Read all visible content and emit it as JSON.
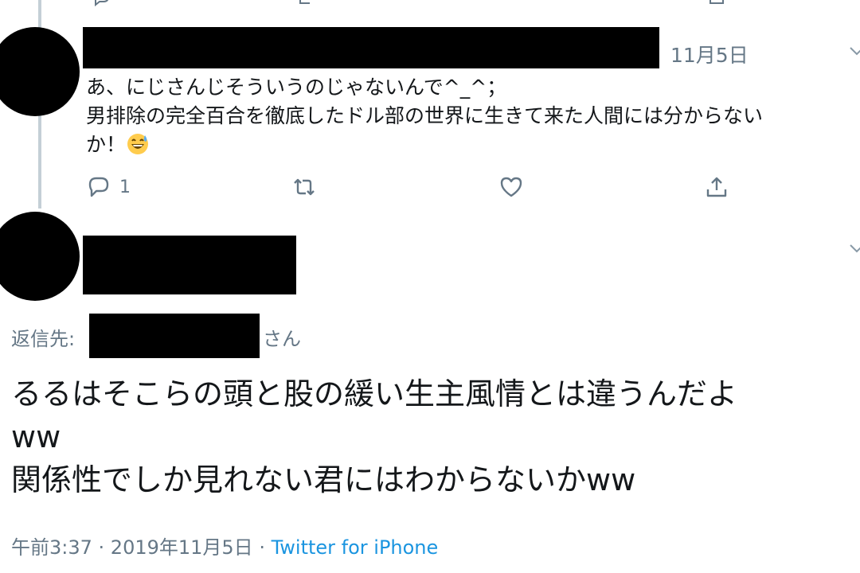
{
  "tweet1": {
    "date": "11月5日",
    "text_lines": [
      "あ、にじさんじそういうのじゃないんで^_^；",
      "男排除の完全百合を徹底したドル部の世界に生きて来た人間には分からない",
      "か！"
    ],
    "emoji": "grinning-face-with-sweat-emoji",
    "reply_count": "1"
  },
  "tweet2": {
    "reply_to_prefix": "返信先:",
    "reply_to_suffix": "さん",
    "text_lines": [
      "るるはそこらの頭と股の緩い生主風情とは違うんだよ",
      "ww",
      "関係性でしか見れない君にはわからないかww"
    ],
    "time": "午前3:37",
    "separator": " · ",
    "date": "2019年11月5日",
    "source": "Twitter for iPhone"
  },
  "colors": {
    "secondary_text": "#657786",
    "link": "#1b95e0",
    "thread_line": "#c4cfd6"
  }
}
